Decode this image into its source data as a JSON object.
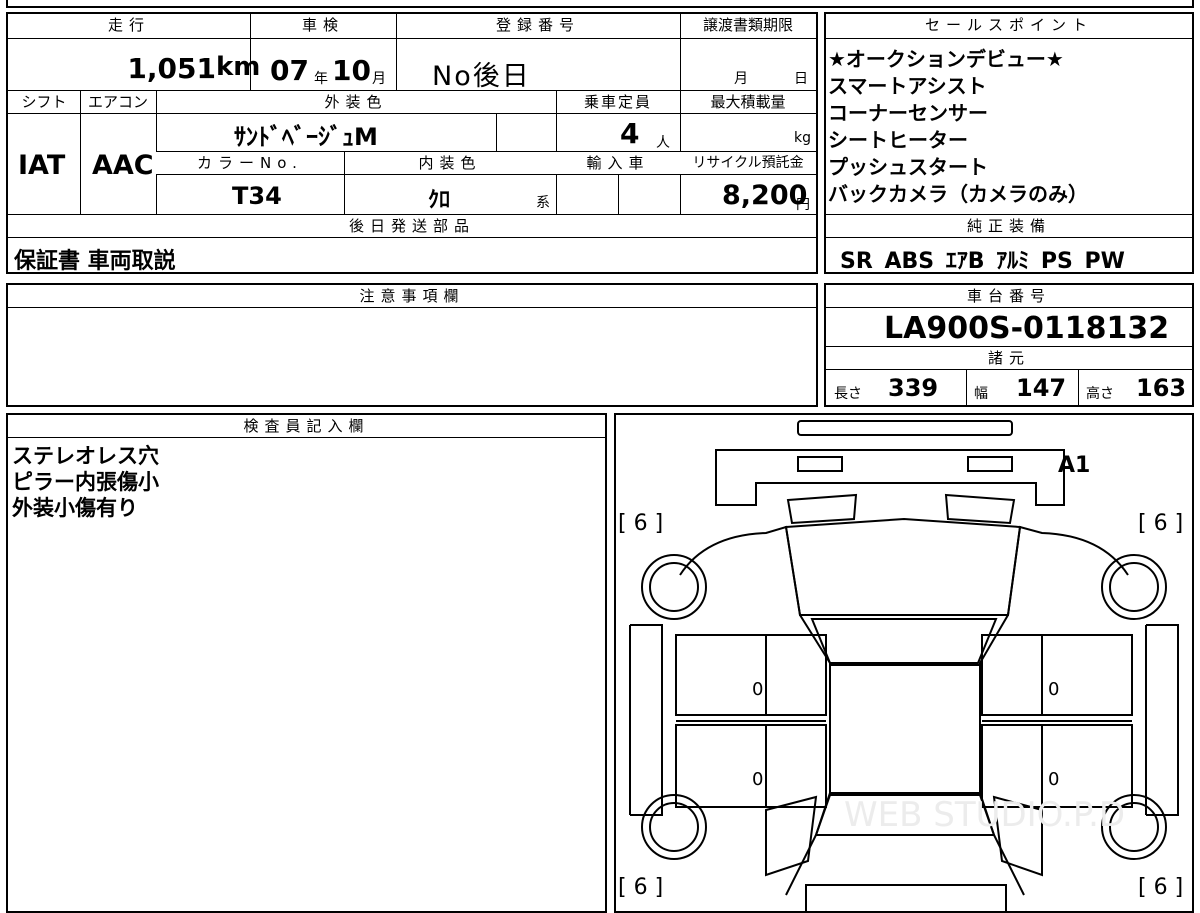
{
  "top_info": {
    "headers": {
      "mileage": "走行",
      "inspection": "車検",
      "registration_number": "登録番号",
      "transfer_deadline": "譲渡書類期限"
    },
    "mileage_value": "1,051",
    "mileage_unit": "km",
    "inspection_year": "07",
    "inspection_year_unit": "年",
    "inspection_month": "10",
    "inspection_month_unit": "月",
    "registration_value": "No後日",
    "deadline_month_unit": "月",
    "deadline_day_unit": "日"
  },
  "middle_info": {
    "headers": {
      "shift": "シフト",
      "aircon": "エアコン",
      "exterior_color": "外装色",
      "capacity": "乗車定員",
      "max_load": "最大積載量",
      "color_no": "カラーNo.",
      "interior_color": "内装色",
      "import": "輸入車",
      "recycle_fee": "リサイクル預託金"
    },
    "shift_value": "IAT",
    "aircon_value": "AAC",
    "exterior_color_value": "ｻﾝﾄﾞﾍﾞｰｼﾞｭM",
    "capacity_value": "4",
    "capacity_unit": "人",
    "max_load_unit": "kg",
    "color_no_value": "T34",
    "interior_color_value": "ｸﾛ",
    "interior_color_suffix": "系",
    "recycle_fee_value": "8,200",
    "recycle_fee_unit": "円"
  },
  "later_parts": {
    "header": "後日発送部品",
    "value": "保証書 車両取説"
  },
  "sales_points": {
    "header": "セールスポイント",
    "items": [
      "★オークションデビュー★",
      "スマートアシスト",
      "コーナーセンサー",
      "シートヒーター",
      "プッシュスタート",
      "バックカメラ（カメラのみ）"
    ]
  },
  "standard_equipment": {
    "header": "純正装備",
    "value": "SR ABS ｴｱB ｱﾙﾐ PS PW"
  },
  "notes": {
    "header": "注意事項欄",
    "value": ""
  },
  "chassis": {
    "header": "車台番号",
    "value": "LA900S-0118132",
    "specs_header": "諸元",
    "length_label": "長さ",
    "length_value": "339",
    "width_label": "幅",
    "width_value": "147",
    "height_label": "高さ",
    "height_value": "163"
  },
  "inspector": {
    "header": "検査員記入欄",
    "lines": [
      "ステレオレス穴",
      "ピラー内張傷小",
      "外装小傷有り"
    ]
  },
  "diagram": {
    "tire_front_left": "[ 6 ]",
    "tire_front_right": "[ 6 ]",
    "tire_rear_left": "[ 6 ]",
    "tire_rear_right": "[ 6 ]",
    "mark_a1": "A1",
    "door_front_left": "0",
    "door_front_right": "0",
    "door_rear_left": "0",
    "door_rear_right": "0",
    "watermark": "WEB STUDIO.P.D"
  }
}
